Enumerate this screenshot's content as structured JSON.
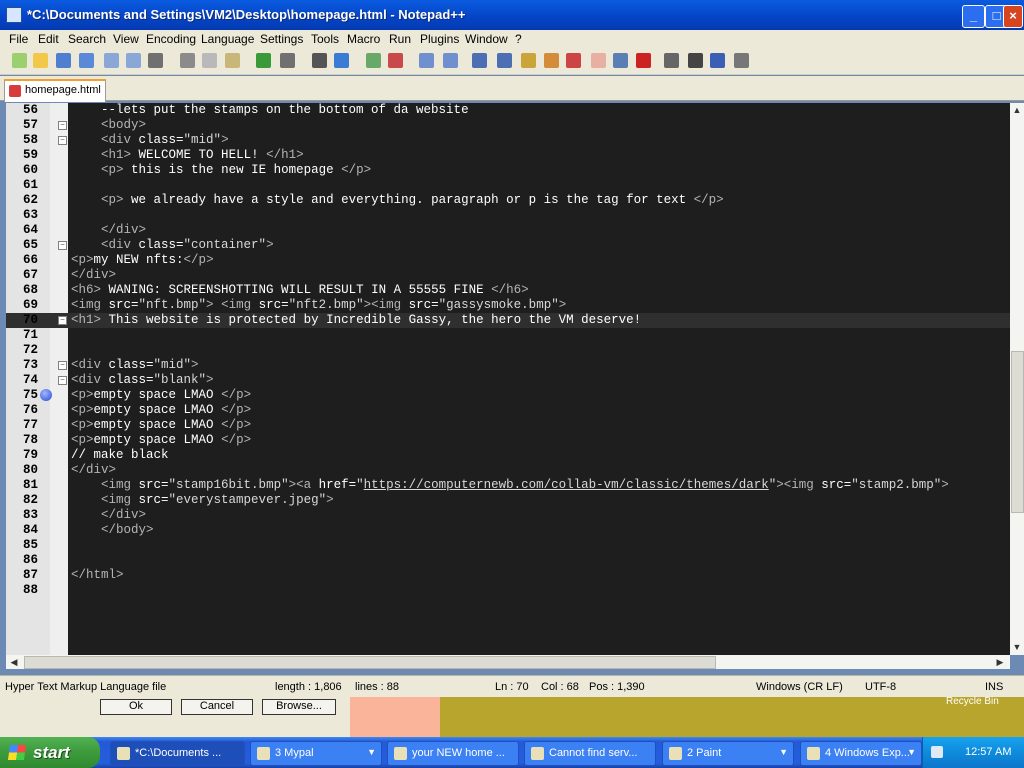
{
  "window": {
    "title": "*C:\\Documents and Settings\\VM2\\Desktop\\homepage.html - Notepad++",
    "controls": [
      "minimize",
      "maximize",
      "close"
    ]
  },
  "menu": [
    "File",
    "Edit",
    "Search",
    "View",
    "Encoding",
    "Language",
    "Settings",
    "Tools",
    "Macro",
    "Run",
    "Plugins",
    "Window",
    "?"
  ],
  "toolbar_icons": [
    "new-file-icon",
    "open-file-icon",
    "save-icon",
    "save-all-icon",
    "close-icon",
    "close-all-icon",
    "print-icon",
    "cut-icon",
    "copy-icon",
    "paste-icon",
    "undo-icon",
    "redo-icon",
    "find-icon",
    "replace-icon",
    "zoom-in-icon",
    "zoom-out-icon",
    "sync-v-icon",
    "sync-h-icon",
    "word-wrap-icon",
    "show-all-chars-icon",
    "indent-guide-icon",
    "doc-map-icon",
    "function-list-icon",
    "folder-workspace-icon",
    "monitor-icon",
    "record-macro-icon",
    "stop-record-icon",
    "play-macro-icon",
    "run-macro-multiple-icon",
    "save-macro-icon"
  ],
  "tab": {
    "label": "homepage.html"
  },
  "editor": {
    "current_line": 70,
    "lines": [
      {
        "n": "56",
        "t": "    --lets put the stamps on the bottom of da website",
        "fold": ""
      },
      {
        "n": "57",
        "t": "    <body>",
        "fold": "-"
      },
      {
        "n": "58",
        "t": "    <div class=\"mid\">",
        "fold": "-"
      },
      {
        "n": "59",
        "t": "    <h1> WELCOME TO HELL! </h1>",
        "fold": ""
      },
      {
        "n": "60",
        "t": "    <p> this is the new IE homepage </p>",
        "fold": ""
      },
      {
        "n": "61",
        "t": "",
        "fold": ""
      },
      {
        "n": "62",
        "t": "    <p> we already have a style and everything. paragraph or p is the tag for text </p>",
        "fold": ""
      },
      {
        "n": "63",
        "t": "",
        "fold": ""
      },
      {
        "n": "64",
        "t": "    </div>",
        "fold": ""
      },
      {
        "n": "65",
        "t": "    <div class=\"container\">",
        "fold": "-"
      },
      {
        "n": "66",
        "t": "<p>my NEW nfts:</p>",
        "fold": ""
      },
      {
        "n": "67",
        "t": "</div>",
        "fold": ""
      },
      {
        "n": "68",
        "t": "<h6> WANING: SCREENSHOTTING WILL RESULT IN A 55555 FINE </h6>",
        "fold": ""
      },
      {
        "n": "69",
        "t": "<img src=\"nft.bmp\"> <img src=\"nft2.bmp\"><img src=\"gassysmoke.bmp\">",
        "fold": ""
      },
      {
        "n": "70",
        "t": "<h1> This website is protected by Incredible Gassy, the hero the VM deserve!",
        "fold": "-"
      },
      {
        "n": "71",
        "t": "",
        "fold": ""
      },
      {
        "n": "72",
        "t": "",
        "fold": ""
      },
      {
        "n": "73",
        "t": "<div class=\"mid\">",
        "fold": "-"
      },
      {
        "n": "74",
        "t": "<div class=\"blank\">",
        "fold": "-"
      },
      {
        "n": "75",
        "t": "<p>empty space LMAO </p>",
        "fold": "",
        "bookmark": true
      },
      {
        "n": "76",
        "t": "<p>empty space LMAO </p>",
        "fold": ""
      },
      {
        "n": "77",
        "t": "<p>empty space LMAO </p>",
        "fold": ""
      },
      {
        "n": "78",
        "t": "<p>empty space LMAO </p>",
        "fold": ""
      },
      {
        "n": "79",
        "t": "// make black",
        "fold": ""
      },
      {
        "n": "80",
        "t": "</div>",
        "fold": ""
      },
      {
        "n": "81",
        "t": "    <img src=\"stamp16bit.bmp\"><a href=\"https://computernewb.com/collab-vm/classic/themes/dark\"><img src=\"stamp2.bmp\">",
        "fold": ""
      },
      {
        "n": "82",
        "t": "    <img src=\"everystampever.jpeg\">",
        "fold": ""
      },
      {
        "n": "83",
        "t": "    </div>",
        "fold": ""
      },
      {
        "n": "84",
        "t": "    </body>",
        "fold": ""
      },
      {
        "n": "85",
        "t": "",
        "fold": ""
      },
      {
        "n": "86",
        "t": "",
        "fold": ""
      },
      {
        "n": "87",
        "t": "</html>",
        "fold": ""
      },
      {
        "n": "88",
        "t": "",
        "fold": ""
      }
    ]
  },
  "status": {
    "file_type": "Hyper Text Markup Language file",
    "length": "length : 1,806",
    "lines": "lines : 88",
    "ln": "Ln : 70",
    "col": "Col : 68",
    "pos": "Pos : 1,390",
    "eol": "Windows (CR LF)",
    "encoding": "UTF-8",
    "mode": "INS"
  },
  "background_dialog": {
    "buttons": [
      "Ok",
      "Cancel",
      "Browse..."
    ],
    "desktop_label": "Recycle Bin"
  },
  "taskbar": {
    "start_label": "start",
    "tasks": [
      {
        "label": "*C:\\Documents ...",
        "active": true,
        "arrow": false
      },
      {
        "label": "3 Mypal",
        "active": false,
        "arrow": true
      },
      {
        "label": "your NEW home ...",
        "active": false,
        "arrow": false
      },
      {
        "label": "Cannot find serv...",
        "active": false,
        "arrow": false
      },
      {
        "label": "2 Paint",
        "active": false,
        "arrow": true
      },
      {
        "label": "4 Windows Exp...",
        "active": false,
        "arrow": true
      }
    ],
    "clock": "12:57 AM"
  },
  "colors": {
    "editor_bg": "#1e1e1e",
    "tag": "#b5b5b5",
    "attr": "#ffffff",
    "string": "#d8d8d8",
    "text": "#ffffff"
  }
}
